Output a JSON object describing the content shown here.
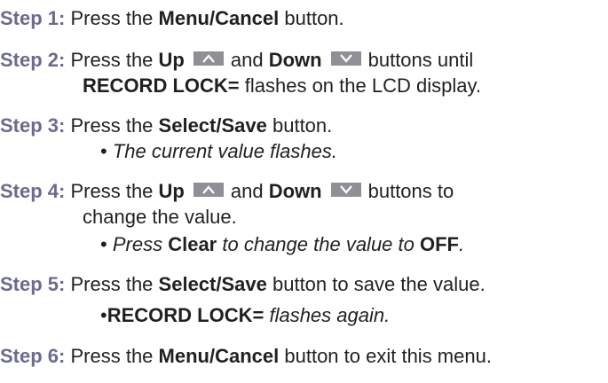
{
  "steps": [
    {
      "label": "Step 1:",
      "pre": "Press the",
      "button": "Menu/Cancel",
      "post": "button."
    },
    {
      "label": "Step 2:",
      "pre": "Press the",
      "up": "Up",
      "and": "and",
      "down": "Down",
      "post": "buttons until",
      "cont_bold": "RECORD LOCK=",
      "cont_post": "flashes on the LCD display."
    },
    {
      "label": "Step 3:",
      "pre": "Press the",
      "button": "Select/Save",
      "post": "button.",
      "note": "The current value flashes."
    },
    {
      "label": "Step 4:",
      "pre": "Press the",
      "up": "Up",
      "and": "and",
      "down": "Down",
      "post": "buttons to",
      "cont": "change the value.",
      "note_pre": "Press",
      "note_bold": "Clear",
      "note_mid": "to change the value to",
      "note_bold2": "OFF",
      "note_end": "."
    },
    {
      "label": "Step 5:",
      "pre": "Press the",
      "button": "Select/Save",
      "post": "button to save the value.",
      "note_bold": "RECORD LOCK=",
      "note_post": "flashes again."
    },
    {
      "label": "Step 6:",
      "pre": "Press the",
      "button": "Menu/Cancel",
      "post": "button to exit this menu."
    }
  ],
  "bullet_char": "•",
  "icons": {
    "up": "up-arrow-button-icon",
    "down": "down-arrow-button-icon",
    "button_color": "#8f8f95",
    "arrow_color": "#ffffff"
  },
  "colors": {
    "step_label": "#6b6b8e",
    "text": "#231f20"
  }
}
